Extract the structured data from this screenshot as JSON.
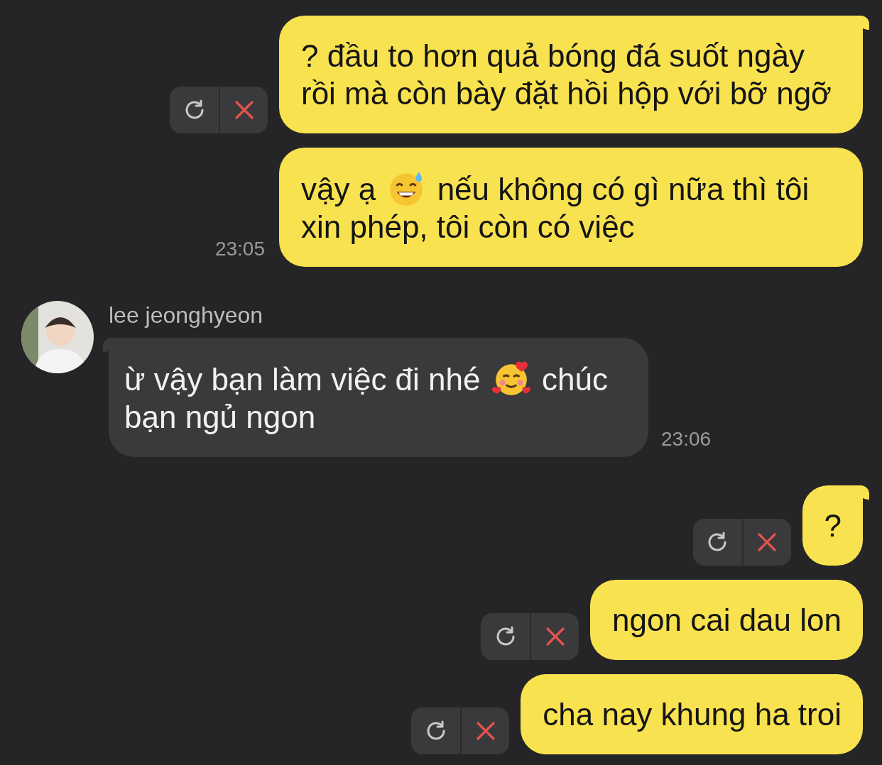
{
  "messages": [
    {
      "kind": "outgoing",
      "tail": true,
      "failed": true,
      "parts": [
        {
          "kind": "text",
          "text": "? đầu to hơn quả bóng đá suốt ngày rồi mà còn bày đặt hồi hộp với bỡ ngỡ"
        }
      ]
    },
    {
      "kind": "outgoing",
      "tail": false,
      "failed": false,
      "time": "23:05",
      "parts": [
        {
          "kind": "text",
          "text": "vậy ạ"
        },
        {
          "kind": "emoji-sweat"
        },
        {
          "kind": "text",
          "text": "nếu không có gì nữa thì tôi xin phép, tôi còn có việc"
        }
      ]
    },
    {
      "kind": "incoming",
      "tail": true,
      "sender": "lee jeonghyeon",
      "time": "23:06",
      "parts": [
        {
          "kind": "text",
          "text": "ừ vậy bạn làm việc đi nhé"
        },
        {
          "kind": "emoji-hearts"
        },
        {
          "kind": "text",
          "text": "chúc bạn ngủ ngon"
        }
      ]
    },
    {
      "kind": "outgoing",
      "tail": true,
      "failed": true,
      "parts": [
        {
          "kind": "text",
          "text": "?"
        }
      ]
    },
    {
      "kind": "outgoing",
      "tail": false,
      "failed": true,
      "parts": [
        {
          "kind": "text",
          "text": "ngon cai dau lon"
        }
      ]
    },
    {
      "kind": "outgoing",
      "tail": false,
      "failed": true,
      "parts": [
        {
          "kind": "text",
          "text": "cha nay khung ha troi"
        }
      ]
    }
  ]
}
